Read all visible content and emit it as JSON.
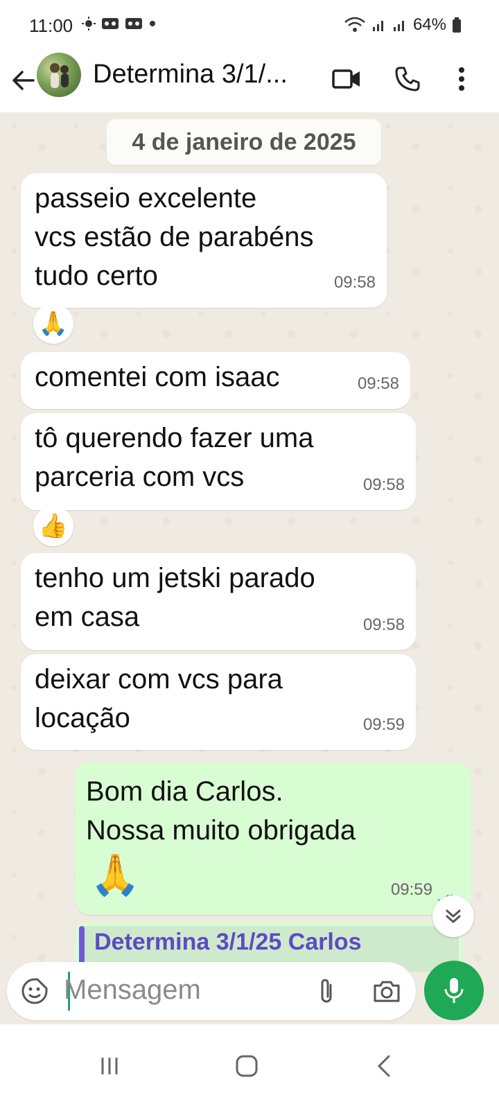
{
  "status_bar": {
    "time": "11:00",
    "battery": "64%"
  },
  "header": {
    "title": "Determina 3/1/..."
  },
  "chat": {
    "date": "4 de janeiro de 2025",
    "messages": [
      {
        "text": "passeio excelente\nvcs estão de parabéns\ntudo certo",
        "time": "09:58",
        "reaction": "🙏"
      },
      {
        "text": "comentei com isaac",
        "time": "09:58"
      },
      {
        "text": "tô querendo fazer uma\nparceria com vcs",
        "time": "09:58",
        "reaction": "👍"
      },
      {
        "text": "tenho um jetski parado\nem casa",
        "time": "09:58"
      },
      {
        "text": "deixar com vcs para\nlocação",
        "time": "09:59"
      }
    ],
    "outgoing": {
      "text": "Bom dia Carlos.\nNossa muito obrigada",
      "emoji": "🙏",
      "time": "09:59"
    },
    "quoted_title": "Determina 3/1/25 Carlos"
  },
  "composer": {
    "placeholder": "Mensagem"
  },
  "colors": {
    "outgoing_bubble": "#d9fdd3",
    "mic_button": "#1fa855",
    "chat_bg": "#efeae2"
  }
}
